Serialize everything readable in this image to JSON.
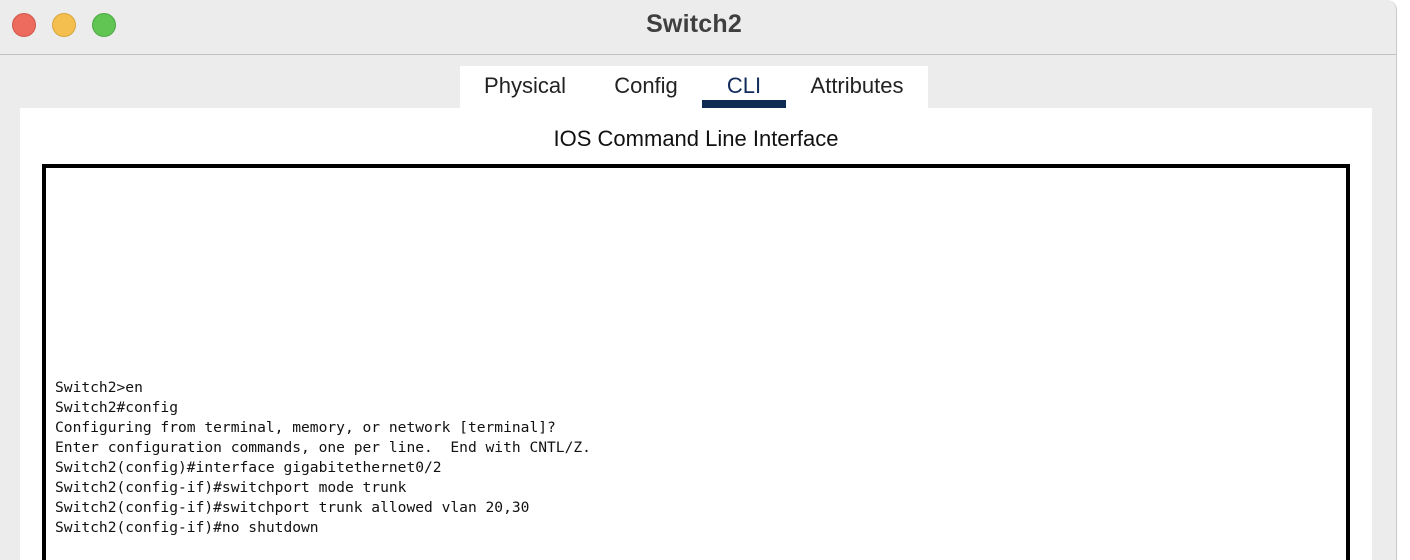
{
  "window": {
    "title": "Switch2"
  },
  "tabs": [
    {
      "label": "Physical"
    },
    {
      "label": "Config"
    },
    {
      "label": "CLI",
      "selected": true
    },
    {
      "label": "Attributes"
    }
  ],
  "panel": {
    "title": "IOS Command Line Interface"
  },
  "terminal": {
    "lines": [
      "Switch2>en",
      "Switch2#config",
      "Configuring from terminal, memory, or network [terminal]?",
      "Enter configuration commands, one per line.  End with CNTL/Z.",
      "Switch2(config)#interface gigabitethernet0/2",
      "Switch2(config-if)#switchport mode trunk",
      "Switch2(config-if)#switchport trunk allowed vlan 20,30",
      "Switch2(config-if)#no shutdown"
    ]
  },
  "colors": {
    "close": "#ed6a5e",
    "minimize": "#f4bf4f",
    "zoom": "#61c554",
    "selected_tab": "#0f2d54"
  }
}
